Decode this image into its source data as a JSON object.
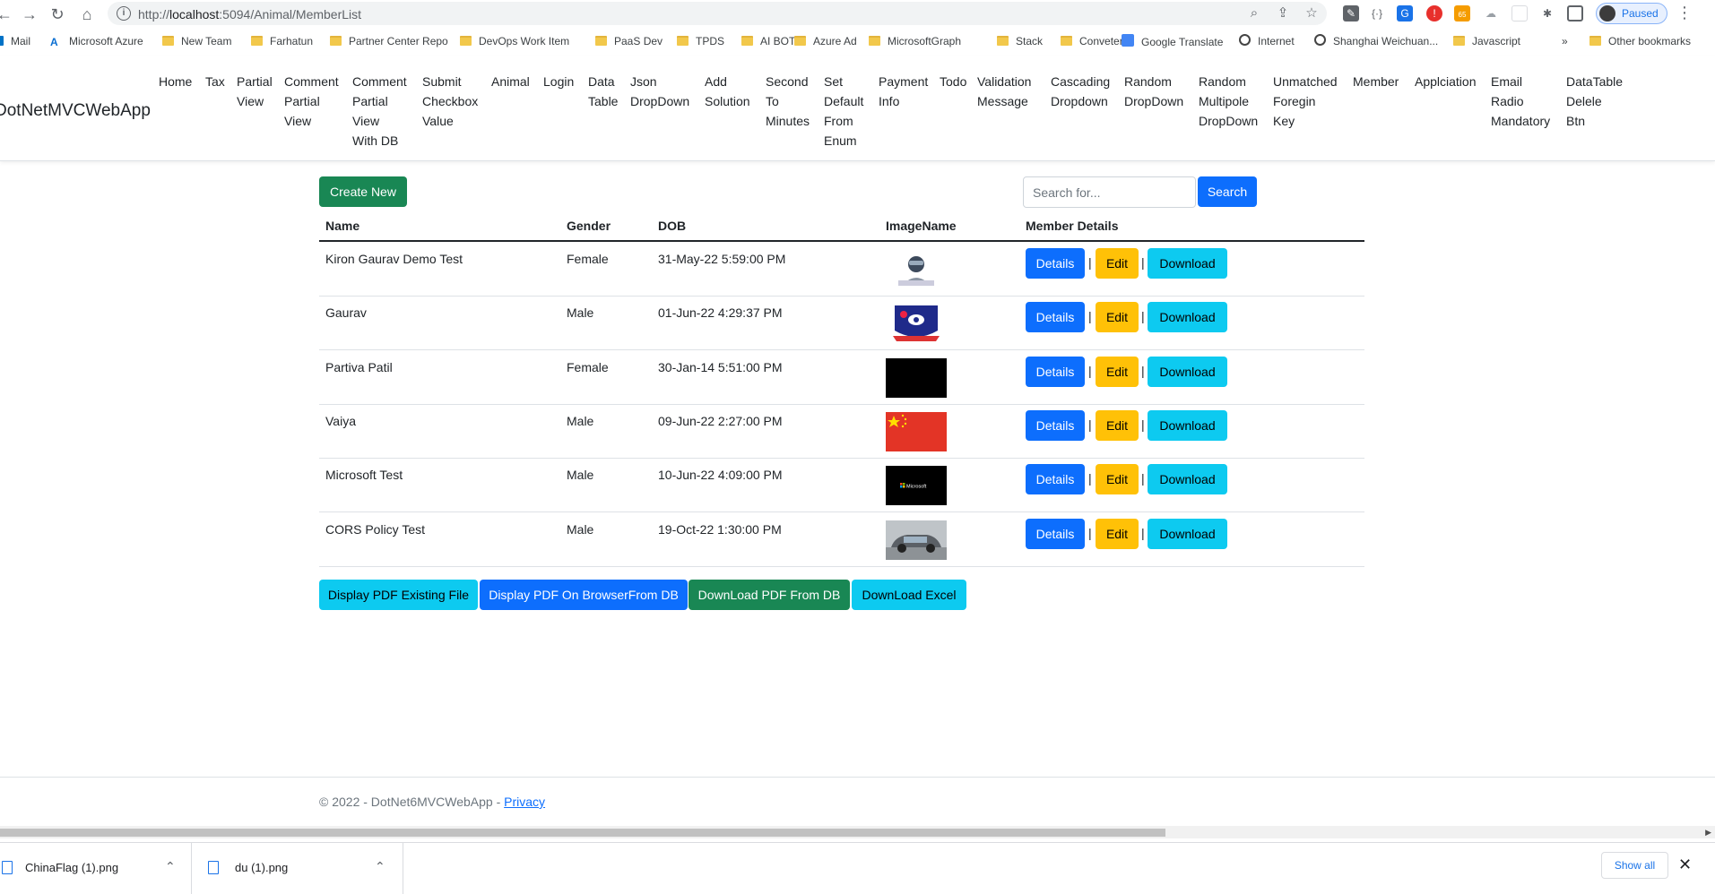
{
  "browser": {
    "url_scheme": "http://",
    "url_host": "localhost",
    "url_path": ":5094/Animal/MemberList",
    "profile_label": "Paused",
    "icons": [
      "back-icon",
      "forward-icon",
      "reload-icon",
      "home-icon",
      "info-icon",
      "zoom-icon",
      "share-icon",
      "star-icon",
      "extensions-icon",
      "sidepanel-icon",
      "kebab-icon"
    ],
    "badge": "65"
  },
  "bookmarks": [
    {
      "label": "Mail",
      "icon": "mail"
    },
    {
      "label": "Microsoft Azure",
      "icon": "azure"
    },
    {
      "label": "New Team",
      "icon": "folder"
    },
    {
      "label": "Farhatun",
      "icon": "folder"
    },
    {
      "label": "Partner Center Repo",
      "icon": "folder"
    },
    {
      "label": "DevOps Work Item",
      "icon": "folder"
    },
    {
      "label": "PaaS Dev",
      "icon": "folder"
    },
    {
      "label": "TPDS",
      "icon": "folder"
    },
    {
      "label": "AI BOT",
      "icon": "folder"
    },
    {
      "label": "Azure Ad",
      "icon": "folder"
    },
    {
      "label": "MicrosoftGraph",
      "icon": "folder"
    },
    {
      "label": "Stack",
      "icon": "folder"
    },
    {
      "label": "Conveter",
      "icon": "folder"
    },
    {
      "label": "Google Translate",
      "icon": "translate"
    },
    {
      "label": "Internet",
      "icon": "globe"
    },
    {
      "label": "Shanghai Weichuan...",
      "icon": "globe"
    },
    {
      "label": "Javascript",
      "icon": "folder"
    }
  ],
  "bookmarks_more": "»",
  "bookmarks_other": "Other bookmarks",
  "app": {
    "brand": "DotNetMVCWebApp",
    "nav": [
      "Home",
      "Tax",
      "Partial\nView",
      "Comment\nPartial\nView",
      "Comment\nPartial\nView\nWith DB",
      "Submit\nCheckbox\nValue",
      "Animal",
      "Login",
      "Data\nTable",
      "Json\nDropDown",
      "Add\nSolution",
      "Second\nTo\nMinutes",
      "Set\nDefault\nFrom\nEnum",
      "Payment\nInfo",
      "Todo",
      "Validation\nMessage",
      "Cascading\nDropdown",
      "Random\nDropDown",
      "Random\nMultipole\nDropDown",
      "Unmatched\nForegin\nKey",
      "Member",
      "Applciation",
      "Email\nRadio\nMandatory",
      "DataTable\nDelele\nBtn"
    ]
  },
  "main": {
    "create_label": "Create New",
    "search_placeholder": "Search for...",
    "search_label": "Search",
    "columns": [
      "Name",
      "Gender",
      "DOB",
      "ImageName",
      "Member Details"
    ],
    "rows": [
      {
        "name": "Kiron Gaurav Demo Test",
        "gender": "Female",
        "dob": "31-May-22 5:59:00 PM",
        "image": "avatar"
      },
      {
        "name": "Gaurav",
        "gender": "Male",
        "dob": "01-Jun-22 4:29:37 PM",
        "image": "emblem"
      },
      {
        "name": "Partiva Patil",
        "gender": "Female",
        "dob": "30-Jan-14 5:51:00 PM",
        "image": "black"
      },
      {
        "name": "Vaiya",
        "gender": "Male",
        "dob": "09-Jun-22 2:27:00 PM",
        "image": "china-flag"
      },
      {
        "name": "Microsoft Test",
        "gender": "Male",
        "dob": "10-Jun-22 4:09:00 PM",
        "image": "microsoft"
      },
      {
        "name": "CORS Policy Test",
        "gender": "Male",
        "dob": "19-Oct-22 1:30:00 PM",
        "image": "car"
      }
    ],
    "row_actions": {
      "details": "Details",
      "edit": "Edit",
      "download": "Download",
      "separator": "|"
    },
    "microsoft_logo_text": "Microsoft",
    "bottom_buttons": [
      "Display PDF Existing File",
      "Display PDF On BrowserFrom DB",
      "DownLoad PDF From DB",
      "DownLoad Excel"
    ]
  },
  "footer": {
    "copyright": "© 2022 - DotNet6MVCWebApp - ",
    "privacy": "Privacy"
  },
  "downloads": {
    "items": [
      "ChinaFlag (1).png",
      "du (1).png"
    ],
    "show_all": "Show all",
    "close": "✕"
  }
}
